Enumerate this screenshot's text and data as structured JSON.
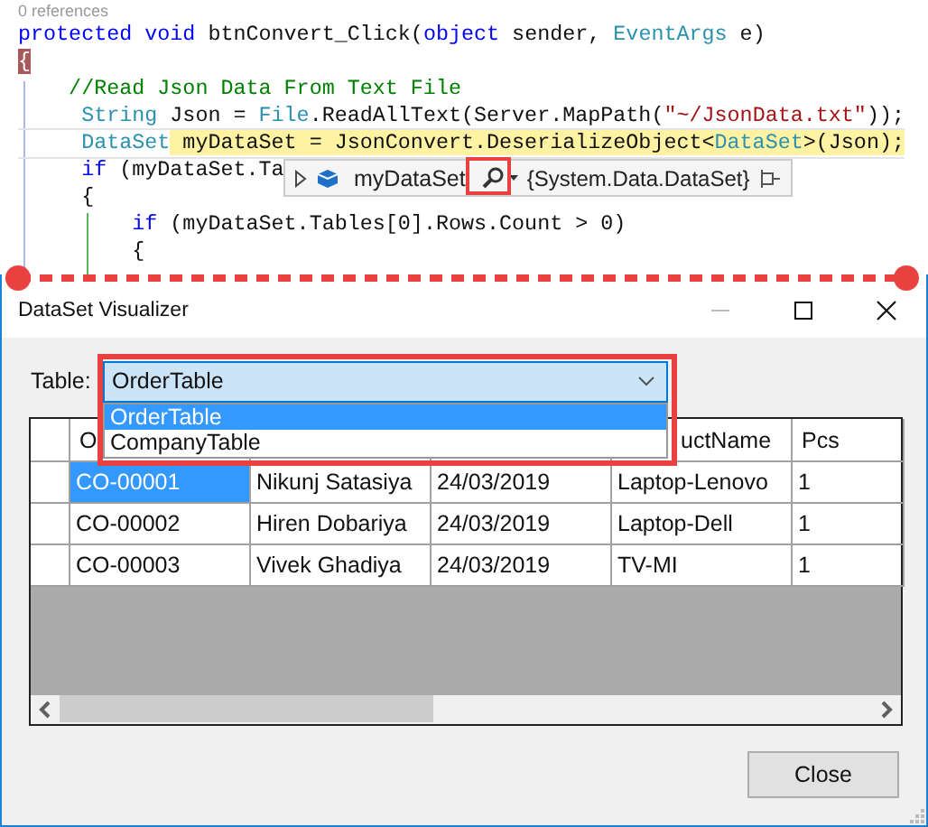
{
  "editor": {
    "references": "0 references",
    "lines": [
      {
        "segments": [
          {
            "kind": "keyword",
            "text": "protected"
          },
          {
            "kind": "keyword",
            "text": " void"
          },
          {
            "kind": "plain",
            "text": " btnConvert_Click("
          },
          {
            "kind": "keyword",
            "text": "object"
          },
          {
            "kind": "plain",
            "text": " sender, "
          },
          {
            "kind": "type",
            "text": "EventArgs"
          },
          {
            "kind": "plain",
            "text": " e)"
          }
        ]
      },
      {
        "segments": [
          {
            "kind": "brace-match",
            "text": "{"
          }
        ]
      },
      {
        "segments": [
          {
            "kind": "comment",
            "text": "    //Read Json Data From Text File"
          }
        ]
      },
      {
        "segments": [
          {
            "kind": "type",
            "text": "     String"
          },
          {
            "kind": "plain",
            "text": " Json = "
          },
          {
            "kind": "type",
            "text": "File"
          },
          {
            "kind": "plain",
            "text": ".ReadAllText(Server.MapPath("
          },
          {
            "kind": "string",
            "text": "\"~/JsonData.txt\""
          },
          {
            "kind": "plain",
            "text": "));"
          }
        ]
      },
      {
        "current": true,
        "segments": [
          {
            "kind": "type",
            "text": "     DataSet",
            "highlighted": false
          },
          {
            "kind": "plain",
            "text": " myDataSet = JsonConvert.DeserializeObject<",
            "highlighted": true
          },
          {
            "kind": "type",
            "text": "DataSet",
            "highlighted": true
          },
          {
            "kind": "plain",
            "text": ">(Json);",
            "highlighted": true
          }
        ]
      },
      {
        "segments": [
          {
            "kind": "keyword",
            "text": "     if"
          },
          {
            "kind": "plain",
            "text": " (myDataSet.Ta"
          }
        ]
      },
      {
        "segments": [
          {
            "kind": "plain",
            "text": "     {"
          }
        ]
      },
      {
        "segments": [
          {
            "kind": "keyword",
            "text": "         if"
          },
          {
            "kind": "plain",
            "text": " (myDataSet.Tables[0].Rows.Count > 0)"
          }
        ]
      },
      {
        "segments": [
          {
            "kind": "plain",
            "text": "         {"
          }
        ]
      }
    ],
    "datatip": {
      "name": "myDataSet",
      "value": "{System.Data.DataSet}"
    }
  },
  "dialog": {
    "title": "DataSet Visualizer",
    "table_label": "Table:",
    "combo": {
      "value": "OrderTable",
      "options": [
        {
          "label": "OrderTable",
          "selected": true
        },
        {
          "label": "CompanyTable",
          "selected": false
        }
      ]
    },
    "grid": {
      "columns": [
        "O",
        "",
        "",
        "uctName",
        "Pcs"
      ],
      "rows": [
        {
          "cells": [
            {
              "text": "CO-00001",
              "selected": true
            },
            {
              "text": "Nikunj Satasiya",
              "selected": false
            },
            {
              "text": "24/03/2019",
              "selected": false
            },
            {
              "text": "Laptop-Lenovo",
              "selected": false
            },
            {
              "text": "1",
              "selected": false
            }
          ]
        },
        {
          "cells": [
            {
              "text": "CO-00002",
              "selected": false
            },
            {
              "text": "Hiren Dobariya",
              "selected": false
            },
            {
              "text": "24/03/2019",
              "selected": false
            },
            {
              "text": "Laptop-Dell",
              "selected": false
            },
            {
              "text": "1",
              "selected": false
            }
          ]
        },
        {
          "cells": [
            {
              "text": "CO-00003",
              "selected": false
            },
            {
              "text": "Vivek Ghadiya",
              "selected": false
            },
            {
              "text": "24/03/2019",
              "selected": false
            },
            {
              "text": "TV-MI",
              "selected": false
            },
            {
              "text": "1",
              "selected": false
            }
          ]
        }
      ]
    },
    "close_button": "Close"
  }
}
